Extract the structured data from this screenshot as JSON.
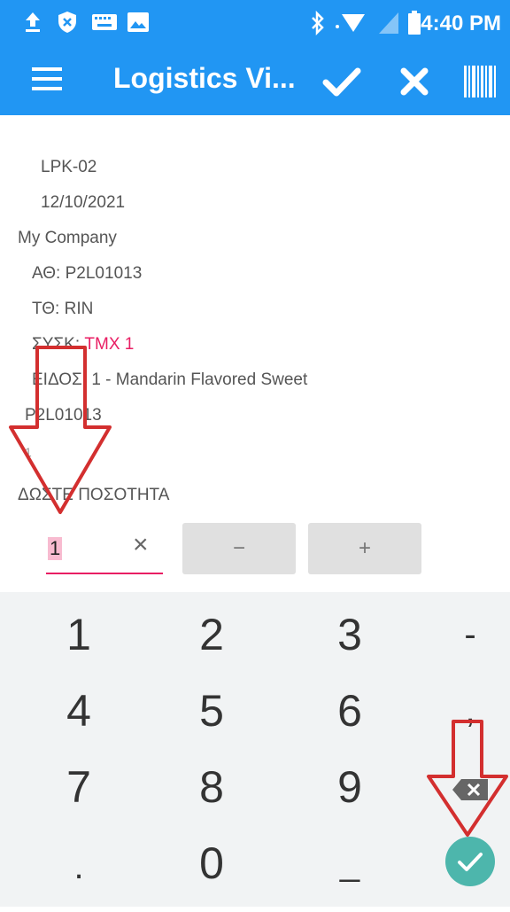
{
  "status_bar": {
    "time": "4:40 PM",
    "icons": [
      "upload-icon",
      "shield-icon",
      "keyboard-icon",
      "image-icon",
      "bluetooth-icon",
      "wifi-icon",
      "signal-icon",
      "battery-icon"
    ]
  },
  "app_bar": {
    "title": "Logistics Vi...",
    "actions": [
      "check-icon",
      "close-icon",
      "barcode-icon"
    ]
  },
  "details": {
    "code": "LPK-02",
    "date": "12/10/2021",
    "company": "My Company",
    "at_label": "ΑΘ:",
    "at_value": "P2L01013",
    "tt_label": "ΤΘ:",
    "tt_value": "RIN",
    "pack_label": "ΣΥΣΚ:",
    "pack_value": "TMX 1",
    "item_label": "ΕΙΔΟΣ:",
    "item_value": "1 - Mandarin Flavored Sweet",
    "lot": "P2L01013",
    "blank_line": "1",
    "prompt": "ΔΩΣΤΕ ΠΟΣΟΤΗΤΑ"
  },
  "quantity": {
    "value": "1",
    "clear": "×",
    "minus": "−",
    "plus": "+"
  },
  "keyboard": {
    "rows": [
      [
        "1",
        "2",
        "3",
        "-"
      ],
      [
        "4",
        "5",
        "6",
        ","
      ],
      [
        "7",
        "8",
        "9",
        "⌫"
      ],
      [
        ".",
        "0",
        "_",
        "✓"
      ]
    ]
  },
  "colors": {
    "primary": "#2196F3",
    "accent": "#E91E63",
    "confirm": "#4DB6AC",
    "annotation": "#D32F2F"
  }
}
